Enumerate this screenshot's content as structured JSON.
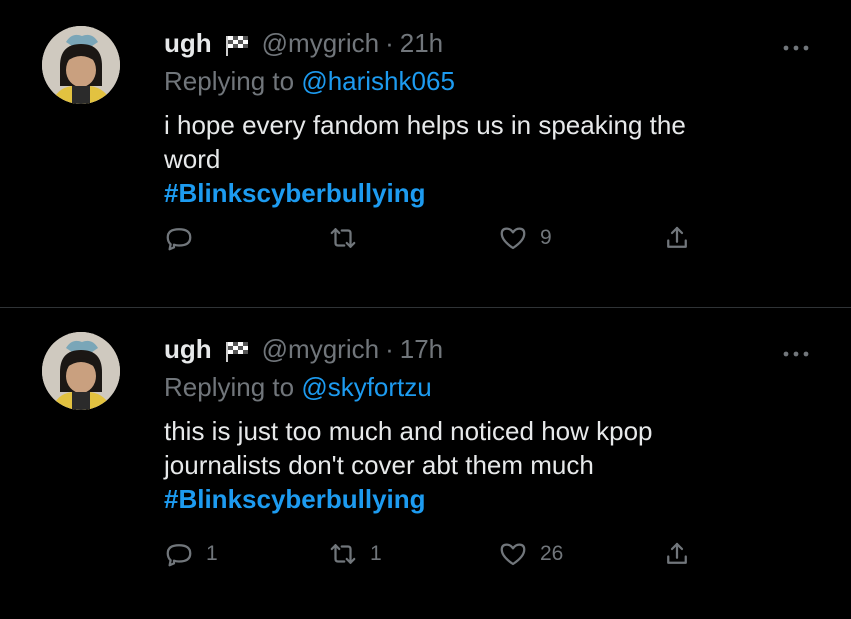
{
  "tweets": [
    {
      "name": "ugh",
      "handle": "@mygrich",
      "separator": "·",
      "time": "21h",
      "replying_prefix": "Replying to ",
      "replying_to": "@harishk065",
      "text_line1": "i hope every fandom helps us in speaking the",
      "text_line2": "word",
      "hashtag": "#Blinkscyberbullying",
      "replies": "",
      "retweets": "",
      "likes": "9"
    },
    {
      "name": "ugh",
      "handle": "@mygrich",
      "separator": "·",
      "time": "17h",
      "replying_prefix": "Replying to ",
      "replying_to": "@skyfortzu",
      "text_line1": "this is just too much and noticed how kpop",
      "text_line2": "journalists don't cover abt them much",
      "hashtag": "#Blinkscyberbullying",
      "replies": "1",
      "retweets": "1",
      "likes": "26"
    }
  ],
  "icons": {
    "more": "more-dots-icon",
    "flag": "checkered-flag-icon",
    "reply": "reply-bubble-icon",
    "retweet": "retweet-icon",
    "like": "heart-icon",
    "share": "share-icon"
  },
  "colors": {
    "background": "#000000",
    "text": "#e7e9ea",
    "muted": "#71767b",
    "link": "#1d9bf0",
    "divider": "#2f3336"
  }
}
